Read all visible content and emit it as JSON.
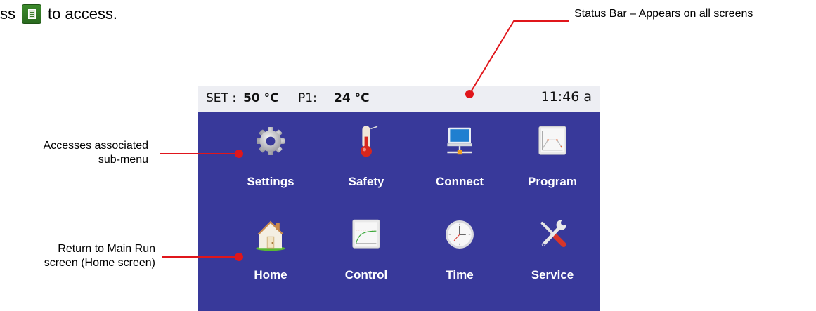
{
  "intro": {
    "prefix": "ss",
    "suffix": "to access."
  },
  "callouts": {
    "status_bar": "Status Bar – Appears on all screens",
    "submenu_line1": "Accesses associated",
    "submenu_line2": "sub-menu",
    "home_line1": "Return to Main Run",
    "home_line2": "screen (Home screen)",
    "line_color": "#e0161b"
  },
  "status_bar": {
    "set_label": "SET :",
    "set_value": "50 °C",
    "p1_label": "P1:",
    "p1_value": "24 °C",
    "clock": "11:46 a"
  },
  "menu": {
    "background": "#38399a",
    "items": [
      {
        "label": "Settings",
        "icon": "gear-icon"
      },
      {
        "label": "Safety",
        "icon": "thermometer-icon"
      },
      {
        "label": "Connect",
        "icon": "computer-network-icon"
      },
      {
        "label": "Program",
        "icon": "program-graph-icon"
      },
      {
        "label": "Home",
        "icon": "house-icon"
      },
      {
        "label": "Control",
        "icon": "control-graph-icon"
      },
      {
        "label": "Time",
        "icon": "clock-icon"
      },
      {
        "label": "Service",
        "icon": "wrench-screwdriver-icon"
      }
    ]
  }
}
